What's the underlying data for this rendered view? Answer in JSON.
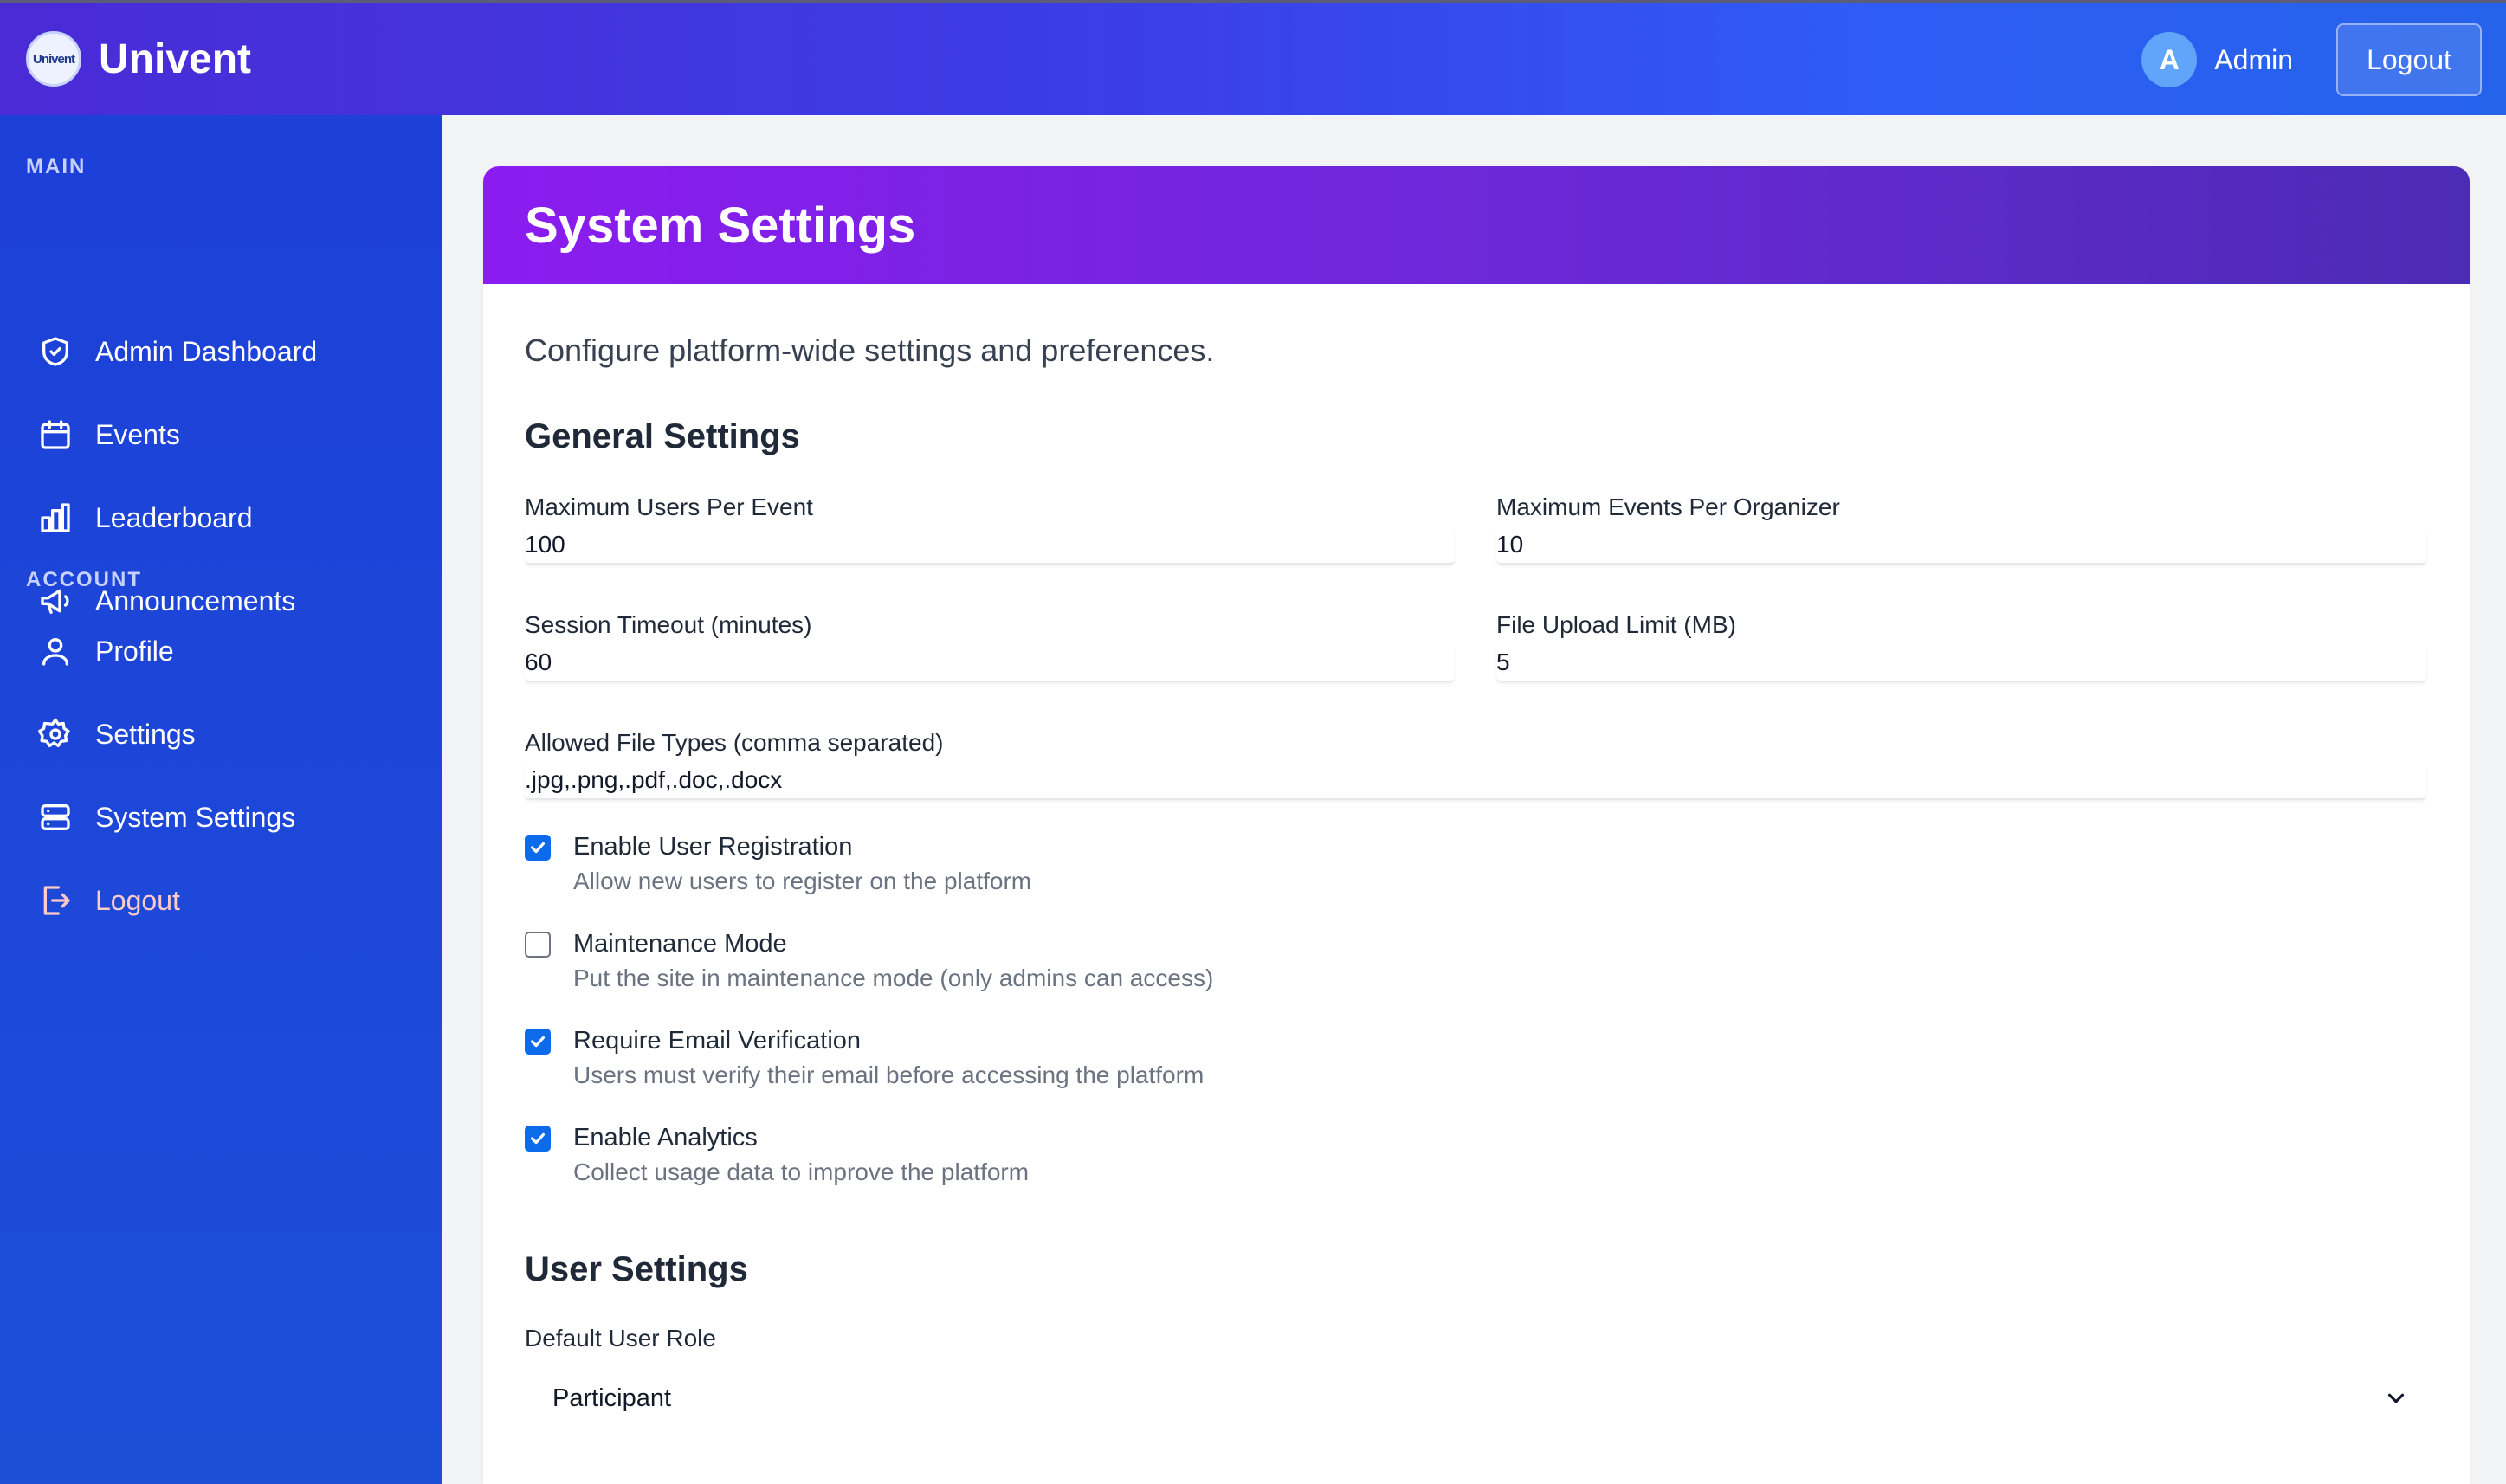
{
  "app": {
    "name": "Univent",
    "logo_text": "Univent"
  },
  "header": {
    "avatar_initial": "A",
    "user_name": "Admin",
    "logout_label": "Logout"
  },
  "sidebar": {
    "main_title": "MAIN",
    "main_items": [
      {
        "label": "Admin Dashboard",
        "icon": "shield-icon"
      },
      {
        "label": "Events",
        "icon": "calendar-icon"
      },
      {
        "label": "Leaderboard",
        "icon": "bar-chart-icon"
      },
      {
        "label": "Announcements",
        "icon": "megaphone-icon"
      }
    ],
    "account_title": "ACCOUNT",
    "account_items": [
      {
        "label": "Profile",
        "icon": "user-icon"
      },
      {
        "label": "Settings",
        "icon": "gear-icon"
      },
      {
        "label": "System Settings",
        "icon": "server-icon"
      },
      {
        "label": "Logout",
        "icon": "logout-icon"
      }
    ]
  },
  "page": {
    "title": "System Settings",
    "description": "Configure platform-wide settings and preferences.",
    "general_title": "General Settings",
    "fields": {
      "max_users": {
        "label": "Maximum Users Per Event",
        "value": "100"
      },
      "max_events": {
        "label": "Maximum Events Per Organizer",
        "value": "10"
      },
      "session_timeout": {
        "label": "Session Timeout (minutes)",
        "value": "60"
      },
      "upload_limit": {
        "label": "File Upload Limit (MB)",
        "value": "5"
      },
      "file_types": {
        "label": "Allowed File Types (comma separated)",
        "value": ".jpg,.png,.pdf,.doc,.docx"
      }
    },
    "checkboxes": [
      {
        "label": "Enable User Registration",
        "help": "Allow new users to register on the platform",
        "checked": true
      },
      {
        "label": "Maintenance Mode",
        "help": "Put the site in maintenance mode (only admins can access)",
        "checked": false
      },
      {
        "label": "Require Email Verification",
        "help": "Users must verify their email before accessing the platform",
        "checked": true
      },
      {
        "label": "Enable Analytics",
        "help": "Collect usage data to improve the platform",
        "checked": true
      }
    ],
    "user_settings_title": "User Settings",
    "default_role": {
      "label": "Default User Role",
      "value": "Participant"
    }
  },
  "colors": {
    "topbar_start": "#4a2bd6",
    "topbar_end": "#2563eb",
    "sidebar": "#1d4ed8",
    "card_header_start": "#8b1cf0",
    "card_header_end": "#4c2bb5",
    "checkbox_accent": "#0b6bea"
  }
}
